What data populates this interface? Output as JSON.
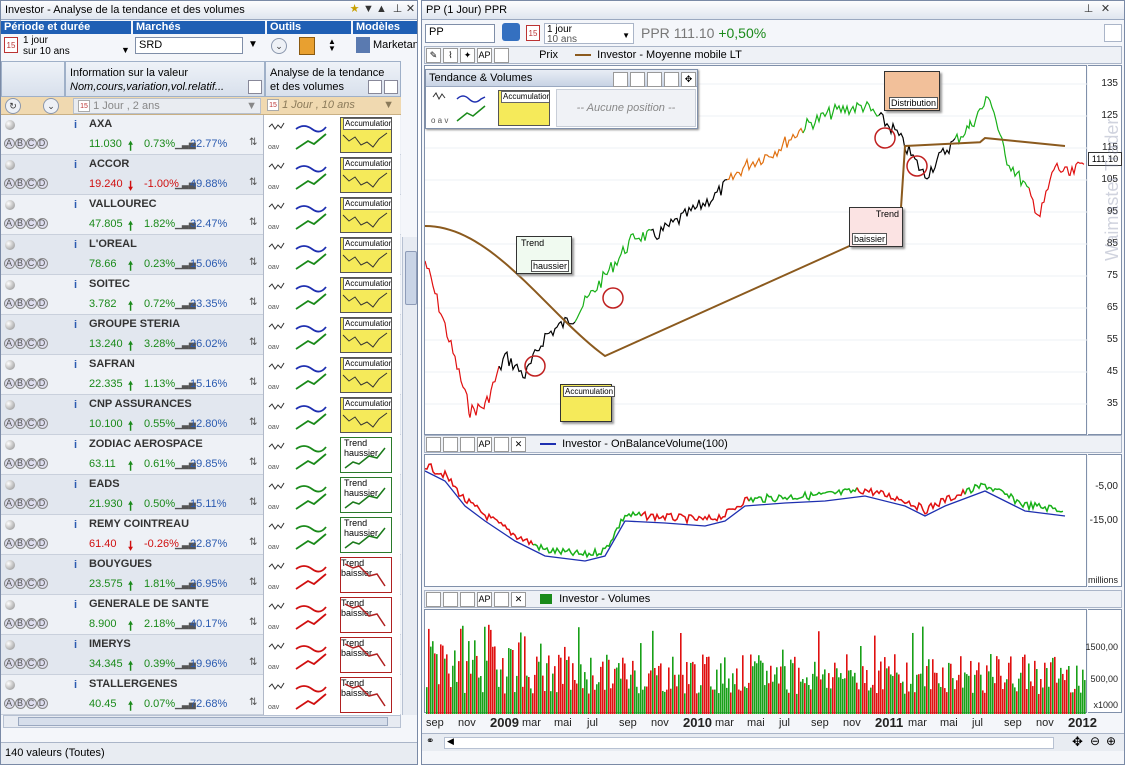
{
  "left": {
    "title": "Investor - Analyse de la tendance et des volumes",
    "headers": {
      "periode": "Période et durée",
      "marches": "Marchés",
      "outils": "Outils",
      "modeles": "Modèles"
    },
    "period": {
      "line1": "1 jour",
      "line2": "sur 10 ans"
    },
    "market_value": "SRD",
    "model_value": "Marketan",
    "col_info": {
      "title": "Information sur la valeur",
      "sub": "Nom,cours,variation,vol.relatif..."
    },
    "col_analysis": {
      "title": "Analyse de la tendance",
      "sub": "et des volumes"
    },
    "sub_period": "1 Jour , 2 ans",
    "sub_period2": "1 Jour , 10 ans",
    "rows": [
      {
        "name": "AXA",
        "price": "11.030",
        "change": "0.73%",
        "vol": "22.77%",
        "dir": "up",
        "badge": "Accumulation"
      },
      {
        "name": "ACCOR",
        "price": "19.240",
        "change": "-1.00%",
        "vol": "49.88%",
        "dir": "dn",
        "badge": "Accumulation"
      },
      {
        "name": "VALLOUREC",
        "price": "47.805",
        "change": "1.82%",
        "vol": "32.47%",
        "dir": "up",
        "badge": "Accumulation"
      },
      {
        "name": "L'OREAL",
        "price": "78.66",
        "change": "0.23%",
        "vol": "15.06%",
        "dir": "up",
        "badge": "Accumulation"
      },
      {
        "name": "SOITEC",
        "price": "3.782",
        "change": "0.72%",
        "vol": "23.35%",
        "dir": "up",
        "badge": "Accumulation"
      },
      {
        "name": "GROUPE STERIA",
        "price": "13.240",
        "change": "3.28%",
        "vol": "26.02%",
        "dir": "up",
        "badge": "Accumulation"
      },
      {
        "name": "SAFRAN",
        "price": "22.335",
        "change": "1.13%",
        "vol": "15.16%",
        "dir": "up",
        "badge": "Accumulation"
      },
      {
        "name": "CNP ASSURANCES",
        "price": "10.100",
        "change": "0.55%",
        "vol": "12.80%",
        "dir": "up",
        "badge": "Accumulation"
      },
      {
        "name": "ZODIAC AEROSPACE",
        "price": "63.11",
        "change": "0.61%",
        "vol": "29.85%",
        "dir": "up",
        "badge": "Trend haussier"
      },
      {
        "name": "EADS",
        "price": "21.930",
        "change": "0.50%",
        "vol": "15.11%",
        "dir": "up",
        "badge": "Trend haussier"
      },
      {
        "name": "REMY COINTREAU",
        "price": "61.40",
        "change": "-0.26%",
        "vol": "22.87%",
        "dir": "dn",
        "badge": "Trend haussier"
      },
      {
        "name": "BOUYGUES",
        "price": "23.575",
        "change": "1.81%",
        "vol": "26.95%",
        "dir": "up",
        "badge": "Trend baissier"
      },
      {
        "name": "GENERALE DE SANTE",
        "price": "8.900",
        "change": "2.18%",
        "vol": "40.17%",
        "dir": "up",
        "badge": "Trend baissier"
      },
      {
        "name": "IMERYS",
        "price": "34.345",
        "change": "0.39%",
        "vol": "19.96%",
        "dir": "up",
        "badge": "Trend baissier"
      },
      {
        "name": "STALLERGENES",
        "price": "40.45",
        "change": "0.07%",
        "vol": "72.68%",
        "dir": "up",
        "badge": "Trend baissier"
      }
    ],
    "status": "140 valeurs (Toutes)"
  },
  "right": {
    "title": "PP (1 Jour) PPR",
    "symbol_input": "PP",
    "period": {
      "line1": "1 jour",
      "line2": "10 ans"
    },
    "quote_name": "PPR",
    "quote_price": "111.10",
    "quote_change": "+0,50%",
    "legend_prix": "Prix",
    "legend_ma": "Investor - Moyenne mobile LT",
    "panel_title": "Tendance & Volumes",
    "panel_pos": "-- Aucune position --",
    "panel_badge": "Accumulation",
    "obv_legend": "Investor - OnBalanceVolume(100)",
    "vol_legend": "Investor - Volumes",
    "notes": {
      "trend_up": "Trend",
      "trend_up2": "haussier",
      "accum": "Accumulation",
      "distrib": "Distribution",
      "trend_dn": "Trend",
      "trend_dn2": "baissier"
    },
    "price_ticks": [
      "135",
      "125",
      "115",
      "105",
      "95",
      "85",
      "75",
      "65",
      "55",
      "45",
      "35"
    ],
    "current_price_tag": "111.10",
    "obv_ticks": [
      "-5,00",
      "-15,00"
    ],
    "obv_unit": "millions",
    "vol_ticks": [
      "1500,00",
      "500,00"
    ],
    "vol_unit": "x1000",
    "x_labels": [
      "sep",
      "nov",
      "2009",
      "mar",
      "mai",
      "jul",
      "sep",
      "nov",
      "2010",
      "mar",
      "mai",
      "jul",
      "sep",
      "nov",
      "2011",
      "mar",
      "mai",
      "jul",
      "sep",
      "nov",
      "2012"
    ],
    "watermark": "Waimaster Trader"
  }
}
